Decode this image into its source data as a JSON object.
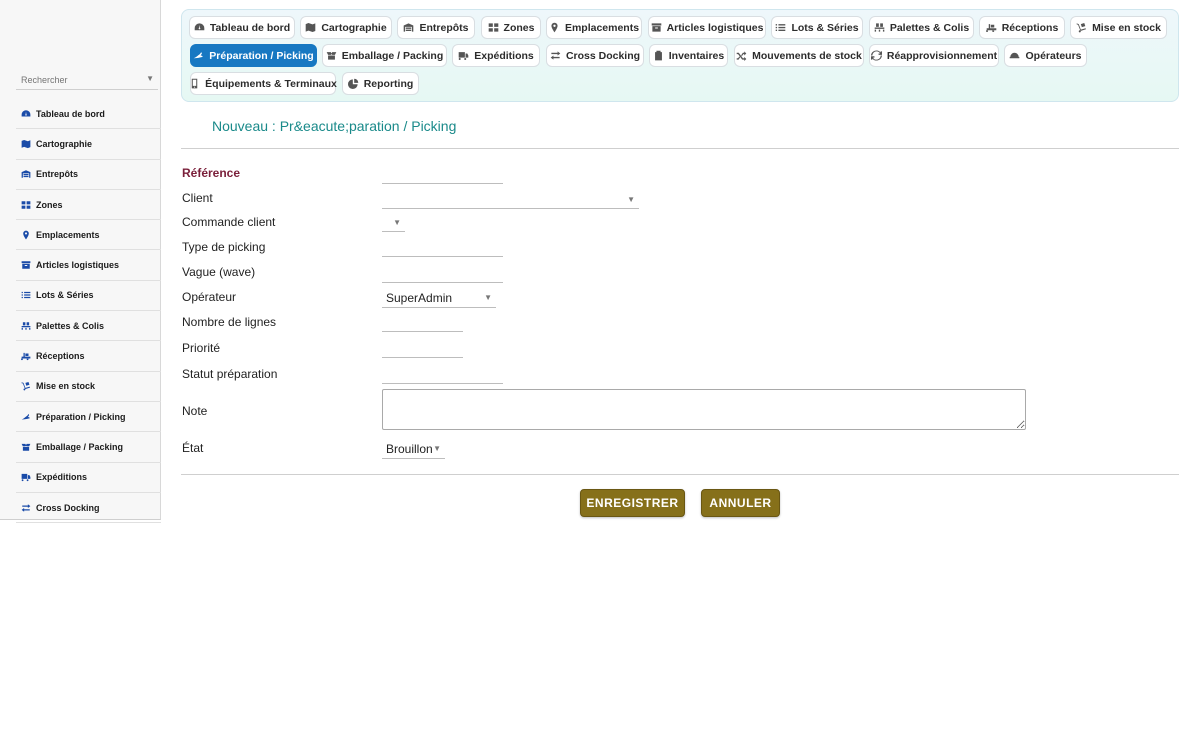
{
  "sidebar": {
    "search": {
      "placeholder": "Rechercher"
    },
    "items": [
      {
        "label": "Tableau de bord",
        "icon": "dashboard-icon"
      },
      {
        "label": "Cartographie",
        "icon": "map-icon"
      },
      {
        "label": "Entrepôts",
        "icon": "warehouse-icon"
      },
      {
        "label": "Zones",
        "icon": "grid-icon"
      },
      {
        "label": "Emplacements",
        "icon": "map-pin-icon"
      },
      {
        "label": "Articles logistiques",
        "icon": "archive-icon"
      },
      {
        "label": "Lots & Séries",
        "icon": "list-icon"
      },
      {
        "label": "Palettes & Colis",
        "icon": "pallet-icon"
      },
      {
        "label": "Réceptions",
        "icon": "truck-loading-icon"
      },
      {
        "label": "Mise en stock",
        "icon": "dolly-icon"
      },
      {
        "label": "Préparation / Picking",
        "icon": "picking-icon"
      },
      {
        "label": "Emballage / Packing",
        "icon": "boxes-icon"
      },
      {
        "label": "Expéditions",
        "icon": "truck-icon"
      },
      {
        "label": "Cross Docking",
        "icon": "exchange-icon"
      }
    ]
  },
  "tabs": [
    {
      "label": "Tableau de bord",
      "icon": "dashboard-icon",
      "active": false
    },
    {
      "label": "Cartographie",
      "icon": "map-icon",
      "active": false
    },
    {
      "label": "Entrepôts",
      "icon": "warehouse-icon",
      "active": false
    },
    {
      "label": "Zones",
      "icon": "grid-icon",
      "active": false
    },
    {
      "label": "Emplacements",
      "icon": "map-pin-icon",
      "active": false
    },
    {
      "label": "Articles logistiques",
      "icon": "archive-icon",
      "active": false
    },
    {
      "label": "Lots & Séries",
      "icon": "list-icon",
      "active": false
    },
    {
      "label": "Palettes & Colis",
      "icon": "pallet-icon",
      "active": false
    },
    {
      "label": "Réceptions",
      "icon": "truck-loading-icon",
      "active": false
    },
    {
      "label": "Mise en stock",
      "icon": "dolly-icon",
      "active": false
    },
    {
      "label": "Préparation / Picking",
      "icon": "picking-icon",
      "active": true
    },
    {
      "label": "Emballage / Packing",
      "icon": "boxes-icon",
      "active": false
    },
    {
      "label": "Expéditions",
      "icon": "truck-icon",
      "active": false
    },
    {
      "label": "Cross Docking",
      "icon": "exchange-icon",
      "active": false
    },
    {
      "label": "Inventaires",
      "icon": "clipboard-check-icon",
      "active": false
    },
    {
      "label": "Mouvements de stock",
      "icon": "random-icon",
      "active": false
    },
    {
      "label": "Réapprovisionnement",
      "icon": "sync-icon",
      "active": false
    },
    {
      "label": "Opérateurs",
      "icon": "hard-hat-icon",
      "active": false
    },
    {
      "label": "Équipements & Terminaux",
      "icon": "mobile-icon",
      "active": false
    },
    {
      "label": "Reporting",
      "icon": "pie-chart-icon",
      "active": false
    }
  ],
  "page": {
    "title": "Nouveau : Pr&eacute;paration / Picking"
  },
  "form": {
    "reference": {
      "label": "Référence",
      "value": ""
    },
    "client": {
      "label": "Client",
      "value": ""
    },
    "commande_client": {
      "label": "Commande client",
      "value": ""
    },
    "type_picking": {
      "label": "Type de picking",
      "value": ""
    },
    "vague": {
      "label": "Vague (wave)",
      "value": ""
    },
    "operateur": {
      "label": "Opérateur",
      "value": "SuperAdmin"
    },
    "nombre_lignes": {
      "label": "Nombre de lignes",
      "value": ""
    },
    "priorite": {
      "label": "Priorité",
      "value": ""
    },
    "statut": {
      "label": "Statut préparation",
      "value": ""
    },
    "note": {
      "label": "Note",
      "value": ""
    },
    "etat": {
      "label": "État",
      "value": "Brouillon"
    }
  },
  "actions": {
    "save": "ENREGISTRER",
    "cancel": "ANNULER"
  },
  "colors": {
    "accent": "#1778c2",
    "title": "#1a8a8a",
    "button": "#86701a",
    "required": "#7a1f3a",
    "icon": "#1a4ba8"
  }
}
